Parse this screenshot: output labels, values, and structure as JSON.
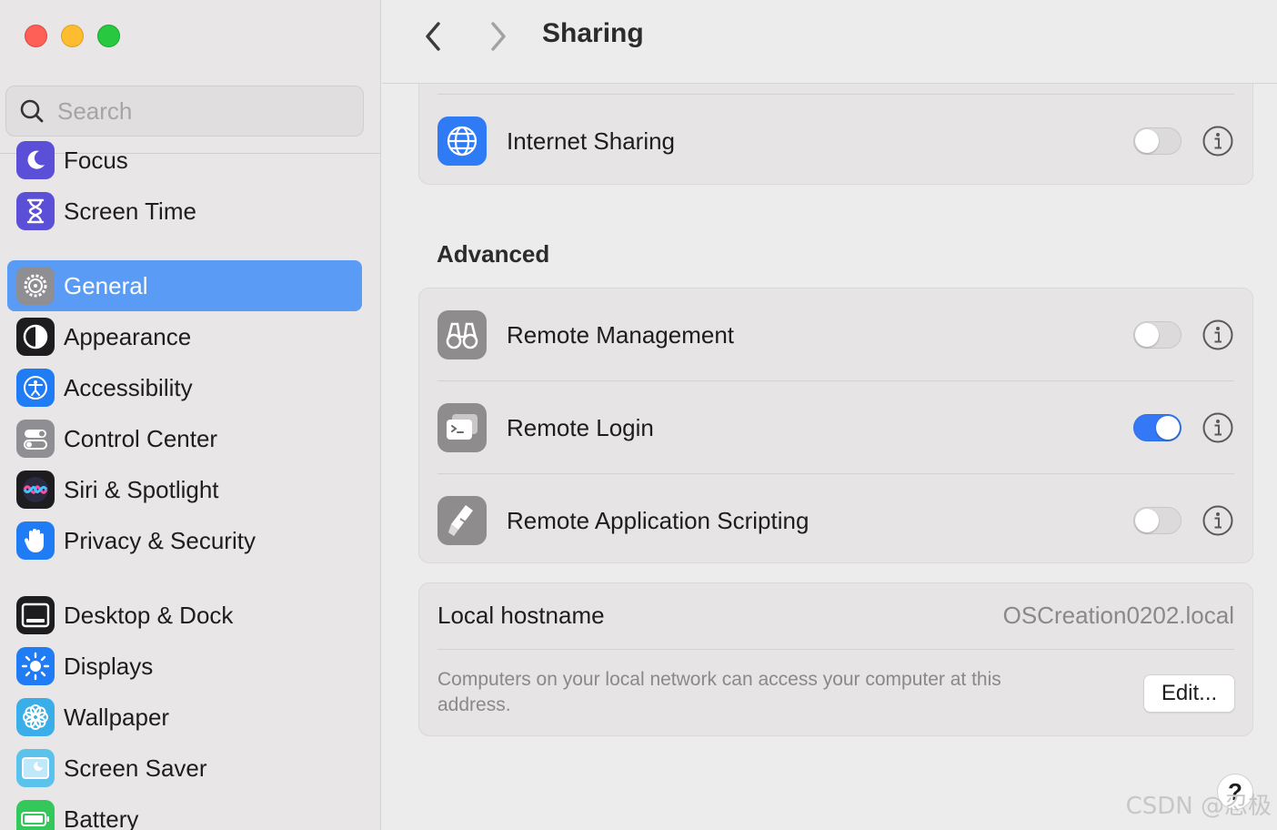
{
  "window": {
    "title": "Sharing"
  },
  "search": {
    "placeholder": "Search"
  },
  "sidebar": {
    "items": [
      {
        "label": "Focus",
        "icon": "moon-icon",
        "color": "#5b4fd8"
      },
      {
        "label": "Screen Time",
        "icon": "hourglass-icon",
        "color": "#5b4fd8"
      },
      {
        "label": "General",
        "icon": "gear-icon",
        "color": "#8e8e93",
        "active": true
      },
      {
        "label": "Appearance",
        "icon": "appearance-icon",
        "color": "#1d1d1f"
      },
      {
        "label": "Accessibility",
        "icon": "accessibility-icon",
        "color": "#1f7cf5"
      },
      {
        "label": "Control Center",
        "icon": "control-center-icon",
        "color": "#8e8e93"
      },
      {
        "label": "Siri & Spotlight",
        "icon": "siri-icon",
        "color": "#1d1d1f"
      },
      {
        "label": "Privacy & Security",
        "icon": "hand-icon",
        "color": "#1f7cf5"
      },
      {
        "label": "Desktop & Dock",
        "icon": "dock-icon",
        "color": "#1d1d1f"
      },
      {
        "label": "Displays",
        "icon": "sun-icon",
        "color": "#1f7cf5"
      },
      {
        "label": "Wallpaper",
        "icon": "flower-icon",
        "color": "#3aaee8"
      },
      {
        "label": "Screen Saver",
        "icon": "screen-saver-icon",
        "color": "#5bc2ec"
      },
      {
        "label": "Battery",
        "icon": "battery-icon",
        "color": "#34c759"
      }
    ]
  },
  "main": {
    "top_card": {
      "items": [
        {
          "label": "Internet Sharing",
          "icon": "globe-icon",
          "enabled": false
        }
      ]
    },
    "advanced": {
      "title": "Advanced",
      "items": [
        {
          "label": "Remote Management",
          "icon": "binoculars-icon",
          "enabled": false
        },
        {
          "label": "Remote Login",
          "icon": "terminal-icon",
          "enabled": true
        },
        {
          "label": "Remote Application Scripting",
          "icon": "script-icon",
          "enabled": false
        }
      ]
    },
    "hostname": {
      "label": "Local hostname",
      "value": "OSCreation0202.local",
      "description": "Computers on your local network can access your computer at this address.",
      "edit_label": "Edit..."
    },
    "help_label": "?"
  },
  "watermark": "CSDN @忍极",
  "colors": {
    "accent": "#3478f6",
    "selection": "#5a9bf5"
  }
}
